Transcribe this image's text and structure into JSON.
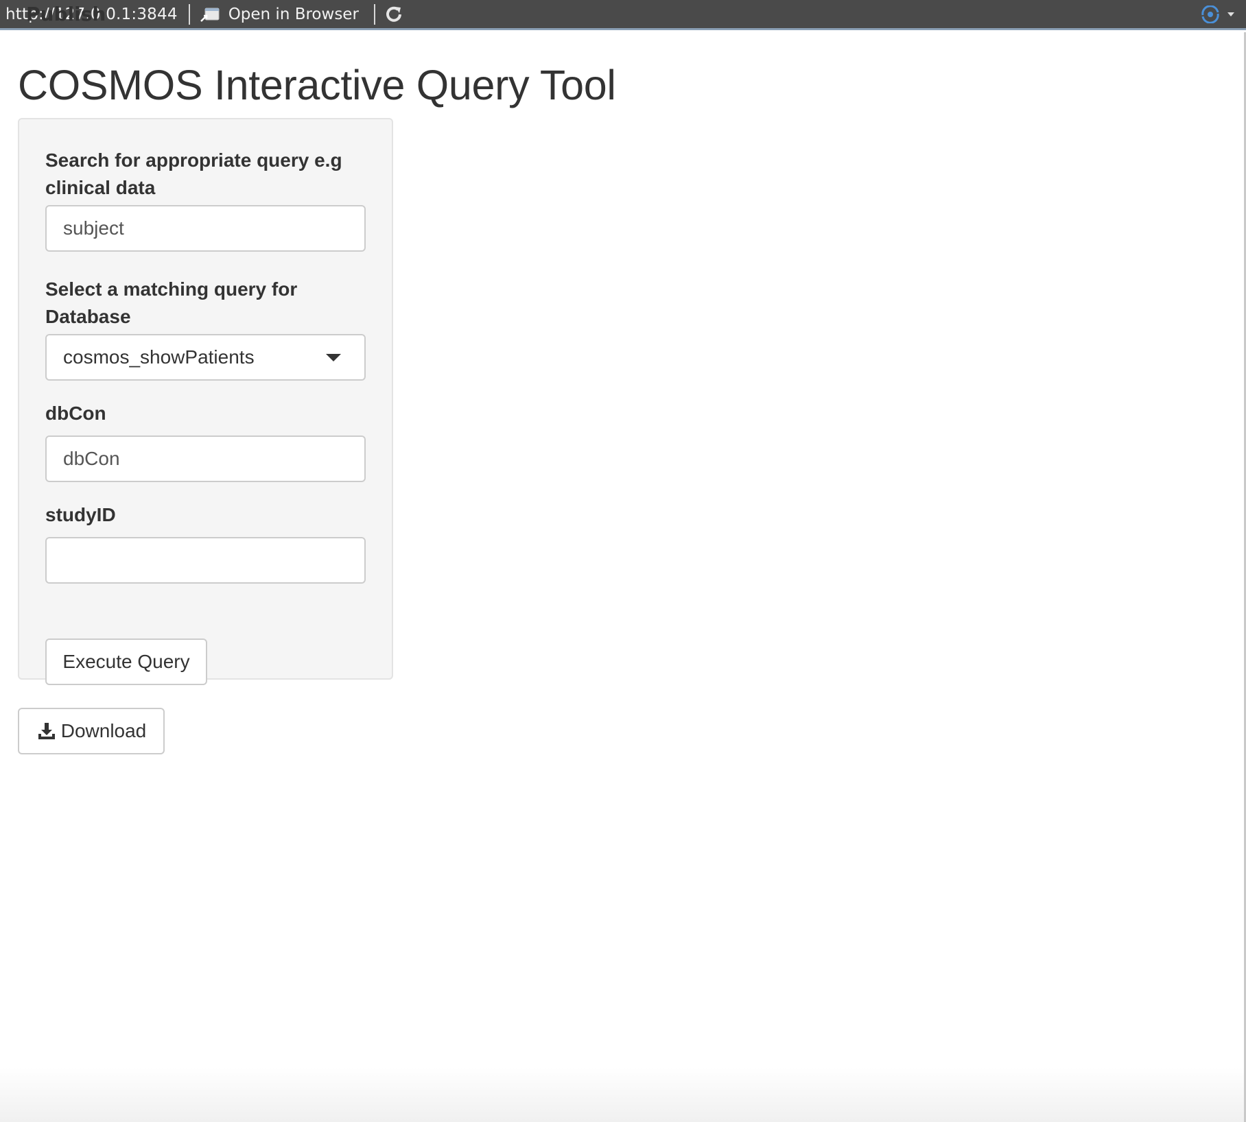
{
  "toolbar": {
    "url": "http://127.0.0.1:3844",
    "open_in_browser_label": "Open in Browser",
    "publish_label": "Publish",
    "accent_color": "#4a90d9"
  },
  "page": {
    "title": "COSMOS Interactive Query Tool"
  },
  "form": {
    "search_label": "Search for appropriate query e.g clinical data",
    "search_value": "subject",
    "select_label": "Select a matching query for Database",
    "select_value": "cosmos_showPatients",
    "dbcon_label": "dbCon",
    "dbcon_value": "dbCon",
    "studyid_label": "studyID",
    "studyid_value": "",
    "execute_label": "Execute Query"
  },
  "download": {
    "label": "Download"
  },
  "icons": {
    "open_in_browser": "open-in-browser-icon",
    "refresh": "refresh-icon",
    "publish": "publish-icon",
    "dropdown": "chevron-down-icon",
    "download": "download-icon"
  }
}
